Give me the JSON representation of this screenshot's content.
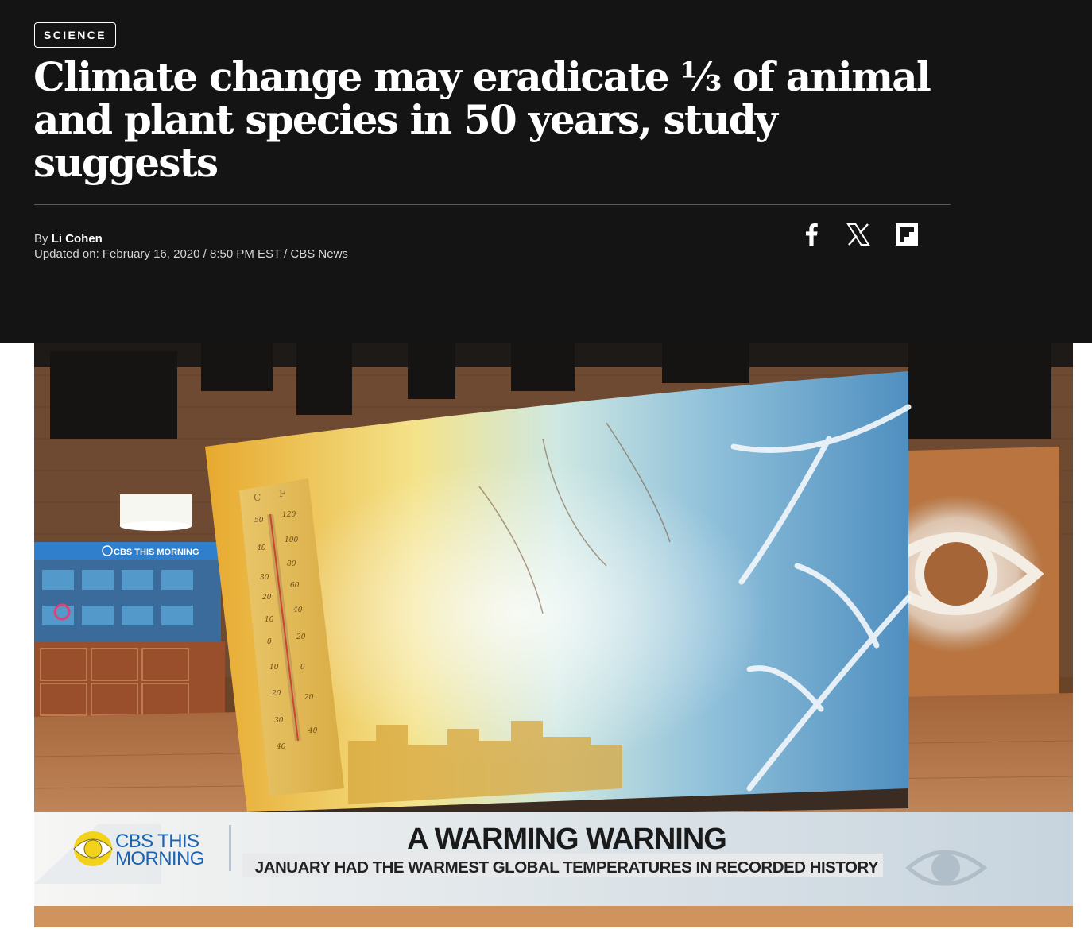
{
  "article": {
    "section": "SCIENCE",
    "headline": "Climate change may eradicate ⅓ of animal and plant species in 50 years, study suggests",
    "byline_prefix": "By",
    "author": "Li Cohen",
    "updated": "Updated on: February 16, 2020 / 8:50 PM EST / CBS News"
  },
  "share": [
    {
      "icon": "facebook-icon"
    },
    {
      "icon": "x-icon"
    },
    {
      "icon": "flipboard-icon"
    }
  ],
  "video": {
    "set_sign": "CBS THIS MORNING",
    "thermometer_units": [
      "C",
      "F"
    ],
    "celsius_ticks": [
      "50",
      "40",
      "30",
      "20",
      "10",
      "0",
      "10",
      "20",
      "30",
      "40"
    ],
    "fahrenheit_ticks": [
      "120",
      "100",
      "80",
      "60",
      "40",
      "20",
      "0",
      "20",
      "40"
    ],
    "show_logo_line1": "CBS THIS",
    "show_logo_line2": "MORNING",
    "lower_third_title": "A WARMING WARNING",
    "lower_third_subtitle": "JANUARY HAD THE WARMEST GLOBAL TEMPERATURES IN RECORDED HISTORY"
  },
  "colors": {
    "hero_background": "#141414",
    "text_primary": "#ffffff",
    "text_secondary": "#d6d6d6",
    "logo_yellow": "#f2d21b",
    "logo_blue": "#1b62b4"
  }
}
